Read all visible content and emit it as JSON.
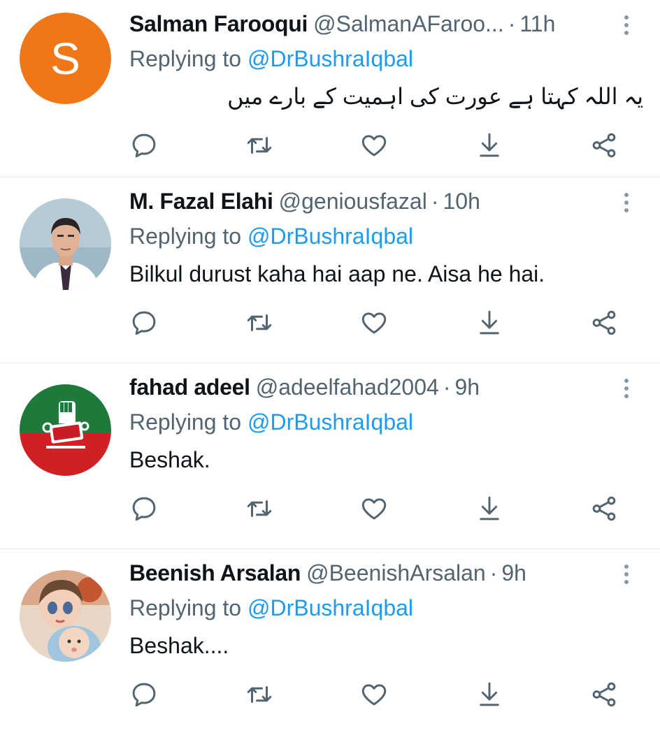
{
  "tweets": [
    {
      "name": "Salman Farooqui",
      "handle": "@SalmanAFaroo...",
      "dot": "·",
      "time": "11h",
      "replying_prefix": "Replying to",
      "replying_to": "@DrBushraIqbal",
      "text": "یہ اللہ کہتا ہے عورت کی اہمیت کے بارے میں",
      "avatar": {
        "type": "letter",
        "letter": "S",
        "color": "#f07718"
      }
    },
    {
      "name": "M. Fazal Elahi",
      "handle": "@geniousfazal",
      "dot": "·",
      "time": "10h",
      "replying_prefix": "Replying to",
      "replying_to": "@DrBushraIqbal",
      "text": "Bilkul durust kaha hai aap ne. Aisa he hai.",
      "avatar": {
        "type": "photo",
        "color": "#9fb8c6"
      }
    },
    {
      "name": "fahad adeel",
      "handle": "@adeelfahad2004",
      "dot": "·",
      "time": "9h",
      "replying_prefix": "Replying to",
      "replying_to": "@DrBushraIqbal",
      "text": "Beshak.",
      "avatar": {
        "type": "logo",
        "color_top": "#1e7a3a",
        "color_bottom": "#d11f26"
      }
    },
    {
      "name": "Beenish Arsalan",
      "handle": "@BeenishArsalan",
      "dot": "·",
      "time": "9h",
      "replying_prefix": "Replying to",
      "replying_to": "@DrBushraIqbal",
      "text": "Beshak....",
      "avatar": {
        "type": "photo",
        "color": "#c9b7a6"
      }
    }
  ],
  "action_icons": [
    "reply-icon",
    "retweet-icon",
    "like-icon",
    "share-icon",
    "share-network-icon"
  ],
  "colors": {
    "accent": "#1d9bf0",
    "muted": "#536471",
    "icon": "#536471",
    "divider": "#e6ecf0"
  }
}
